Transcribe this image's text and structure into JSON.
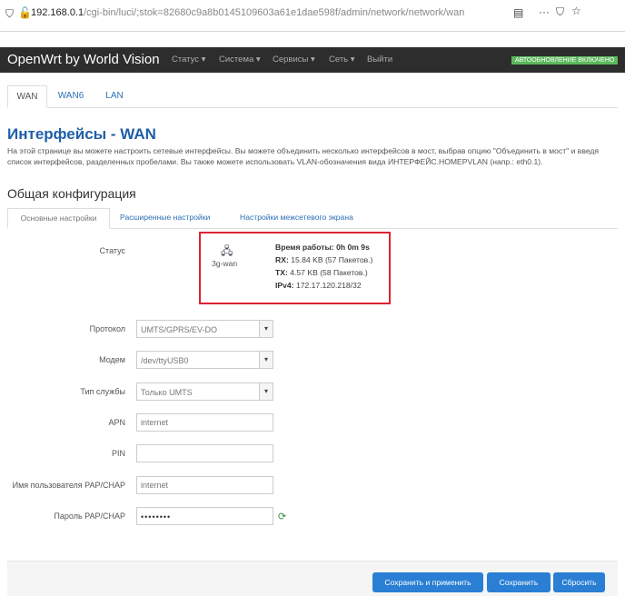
{
  "browser": {
    "url_host": "192.168.0.1",
    "url_path": "/cgi-bin/luci/;stok=82680c9a8b0145109603a61e1dae598f/admin/network/network/wan"
  },
  "navbar": {
    "brand": "OpenWrt by World Vision",
    "menu": [
      "Статус",
      "Система",
      "Сервисы",
      "Сеть",
      "Выйти"
    ],
    "autoupdate_badge": "АВТООБНОВЛЕНИЕ ВКЛЮЧЕНО"
  },
  "tabs": [
    "WAN",
    "WAN6",
    "LAN"
  ],
  "page": {
    "title": "Интерфейсы - WAN",
    "description": "На этой странице вы можете настроить сетевые интерфейсы. Вы можете объединить несколько интерфейсов в мост, выбрав опцию \"Объединить в мост\" и введя список интерфейсов, разделенных пробелами. Вы также можете использовать VLAN-обозначения вида ИНТЕРФЕЙС.НОМЕРVLAN (напр.: eth0.1).",
    "section_title": "Общая конфигурация"
  },
  "subtabs": [
    "Основные настройки",
    "Расширенные настройки",
    "Настройки межсетевого экрана"
  ],
  "status": {
    "label": "Статус",
    "iface": "3g-wan",
    "uptime_label": "Время работы:",
    "uptime": "0h 0m 9s",
    "rx_label": "RX:",
    "rx": "15.84 KB (57 Пакетов.)",
    "tx_label": "TX:",
    "tx": "4.57 KB (58 Пакетов.)",
    "ipv4_label": "IPv4:",
    "ipv4": "172.17.120.218/32"
  },
  "form": {
    "protocol_label": "Протокол",
    "protocol": "UMTS/GPRS/EV-DO",
    "modem_label": "Модем",
    "modem": "/dev/ttyUSB0",
    "service_label": "Тип службы",
    "service": "Только UMTS",
    "apn_label": "APN",
    "apn": "internet",
    "pin_label": "PIN",
    "pin": "",
    "user_label": "Имя пользователя PAP/CHAP",
    "user": "internet",
    "pass_label": "Пароль PAP/CHAP",
    "pass": "••••••••"
  },
  "footer": {
    "save_apply": "Сохранить и применить",
    "save": "Сохранить",
    "reset": "Сбросить"
  },
  "colors": {
    "accent": "#2a7fd4",
    "navbar": "#2d2d2d",
    "badge": "#5cb85c",
    "highlight_border": "#dd2233"
  }
}
